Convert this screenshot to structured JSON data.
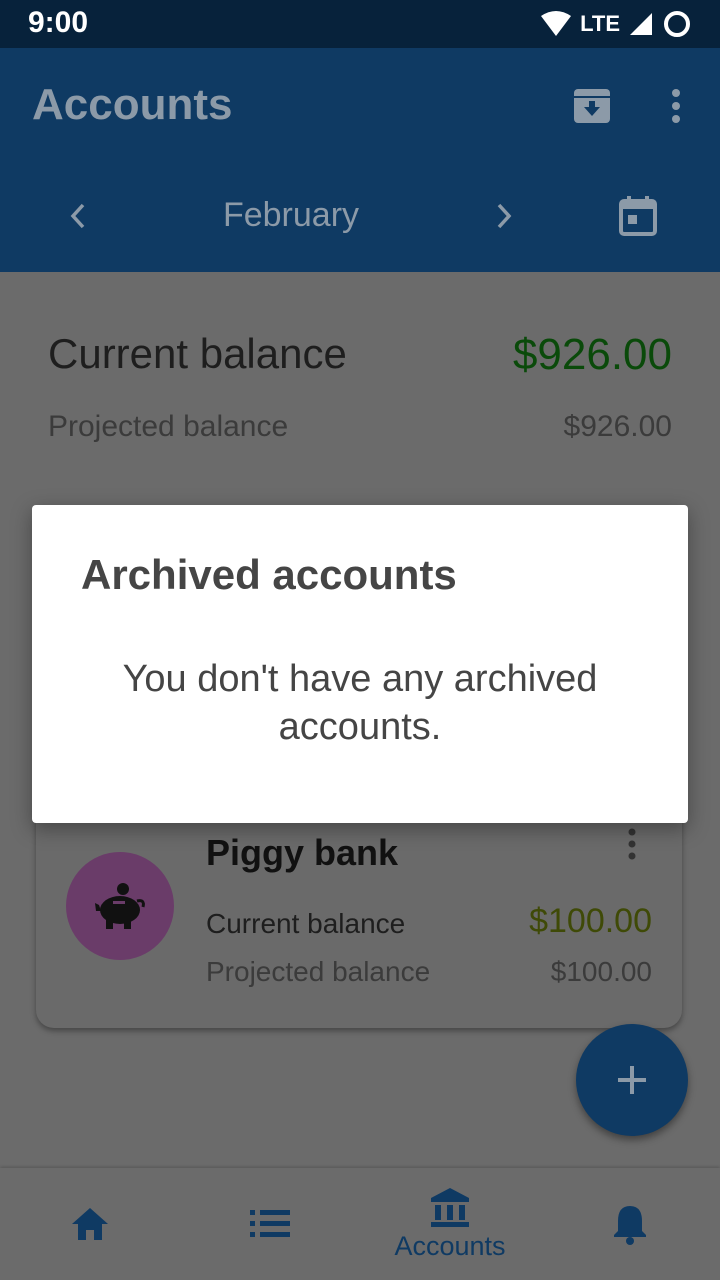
{
  "status_bar": {
    "time": "9:00",
    "network": "LTE"
  },
  "app_bar": {
    "title": "Accounts",
    "month": "February"
  },
  "summary": {
    "current_label": "Current balance",
    "current_value": "$926.00",
    "projected_label": "Projected balance",
    "projected_value": "$926.00"
  },
  "account_card": {
    "name": "Piggy bank",
    "current_label": "Current balance",
    "current_value": "$100.00",
    "projected_label": "Projected balance",
    "projected_value": "$100.00",
    "icon": "piggy-bank-icon"
  },
  "fab": {
    "icon": "plus-icon"
  },
  "bottom_nav": {
    "items": [
      {
        "icon": "home-icon",
        "label": ""
      },
      {
        "icon": "list-icon",
        "label": ""
      },
      {
        "icon": "bank-icon",
        "label": "Accounts",
        "active": true
      },
      {
        "icon": "bell-icon",
        "label": ""
      }
    ]
  },
  "dialog": {
    "title": "Archived accounts",
    "message": "You don't have any archived accounts."
  },
  "colors": {
    "primary": "#1565c0",
    "positive": "#1b8f1b",
    "avatar": "#d37fd0"
  }
}
